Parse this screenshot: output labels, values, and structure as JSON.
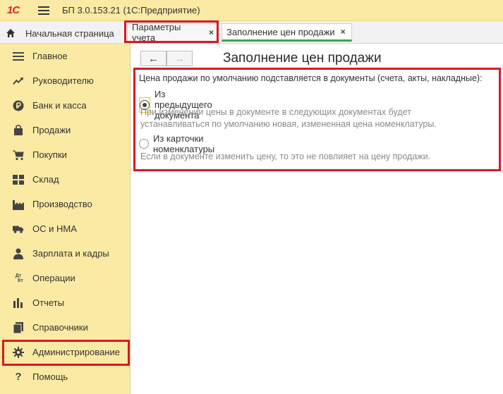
{
  "app": {
    "logo": "1С",
    "title": "БП 3.0.153.21  (1С:Предприятие)"
  },
  "tabs": {
    "home": "Начальная страница",
    "items": [
      {
        "label": "Параметры учета",
        "close": "×"
      },
      {
        "label": "Заполнение цен продажи",
        "close": "×"
      }
    ]
  },
  "sidebar": {
    "items": [
      {
        "label": "Главное",
        "icon": "menu-lines-icon"
      },
      {
        "label": "Руководителю",
        "icon": "trend-icon"
      },
      {
        "label": "Банк и касса",
        "icon": "ruble-coin-icon"
      },
      {
        "label": "Продажи",
        "icon": "shopping-bag-icon"
      },
      {
        "label": "Покупки",
        "icon": "cart-icon"
      },
      {
        "label": "Склад",
        "icon": "warehouse-grid-icon"
      },
      {
        "label": "Производство",
        "icon": "factory-icon"
      },
      {
        "label": "ОС и НМА",
        "icon": "truck-icon"
      },
      {
        "label": "Зарплата и кадры",
        "icon": "person-icon"
      },
      {
        "label": "Операции",
        "icon": "debit-credit-icon"
      },
      {
        "label": "Отчеты",
        "icon": "bar-chart-icon"
      },
      {
        "label": "Справочники",
        "icon": "books-icon"
      },
      {
        "label": "Администрирование",
        "icon": "gear-icon"
      },
      {
        "label": "Помощь",
        "icon": "question-icon"
      }
    ],
    "debit_credit_text": {
      "top": "Дт",
      "bottom": "Кт"
    }
  },
  "page": {
    "title": "Заполнение цен продажи",
    "nav_back": "←",
    "nav_forward": "→",
    "question": "Цена продажи по умолчанию подставляется в документы (счета, акты, накладные):",
    "options": [
      {
        "label": "Из предыдущего документа",
        "checked": true,
        "hint_line1": "При изменении цены в документе в следующих документах будет",
        "hint_line2": "устанавливаться по умолчанию новая, измененная цена номенклатуры."
      },
      {
        "label": "Из карточки номенклатуры",
        "checked": false,
        "hint_line1": "Если в документе изменить цену, то это не повлияет на цену продажи."
      }
    ]
  },
  "colors": {
    "accent_highlight": "#d61a26",
    "sidebar_bg": "#fbeaa3",
    "active_tab_underline": "#3aa357"
  }
}
